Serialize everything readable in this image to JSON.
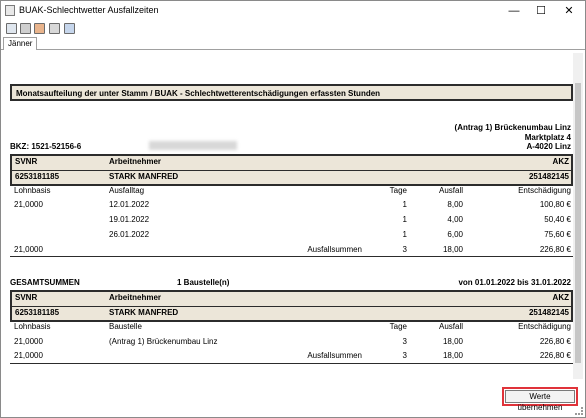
{
  "window": {
    "title": "BUAK-Schlechtwetter Ausfallzeiten"
  },
  "controls": {
    "minimize": "—",
    "maximize": "☐",
    "close": "✕"
  },
  "tabs": [
    {
      "label": "Jänner"
    }
  ],
  "report": {
    "heading": "Monatsaufteilung der unter Stamm / BUAK - Schlechtwetterentschädigungen erfassten Stunden",
    "address": {
      "line1": "(Antrag 1) Brückenumbau Linz",
      "line2": "Marktplatz 4",
      "line3": "A-4020 Linz"
    },
    "bkz": "BKZ: 1521-52156-6",
    "section1": {
      "header": {
        "svnr_label": "SVNR",
        "arbeitnehmer_label": "Arbeitnehmer",
        "akz_label": "AKZ"
      },
      "employee": {
        "svnr": "6253181185",
        "name": "STARK MANFRED",
        "akz": "251482145"
      },
      "columns": {
        "lohnbasis": "Lohnbasis",
        "ausfalltag": "Ausfalltag",
        "tage": "Tage",
        "ausfall": "Ausfall",
        "entschaedigung": "Entschädigung"
      },
      "rows": [
        {
          "lohnbasis": "21,0000",
          "datum": "12.01.2022",
          "tage": "1",
          "ausfall": "8,00",
          "entschaedigung": "100,80 €"
        },
        {
          "lohnbasis": "",
          "datum": "19.01.2022",
          "tage": "1",
          "ausfall": "4,00",
          "entschaedigung": "50,40 €"
        },
        {
          "lohnbasis": "",
          "datum": "26.01.2022",
          "tage": "1",
          "ausfall": "6,00",
          "entschaedigung": "75,60 €"
        }
      ],
      "sum": {
        "lohnbasis": "21,0000",
        "label": "Ausfallsummen",
        "tage": "3",
        "ausfall": "18,00",
        "entschaedigung": "226,80 €"
      }
    },
    "totals": {
      "label": "GESAMTSUMMEN",
      "baustellen": "1 Baustelle(n)",
      "period": "von 01.01.2022 bis 31.01.2022",
      "header": {
        "svnr_label": "SVNR",
        "arbeitnehmer_label": "Arbeitnehmer",
        "akz_label": "AKZ"
      },
      "employee": {
        "svnr": "6253181185",
        "name": "STARK MANFRED",
        "akz": "251482145"
      },
      "columns": {
        "lohnbasis": "Lohnbasis",
        "baustelle": "Baustelle",
        "tage": "Tage",
        "ausfall": "Ausfall",
        "entschaedigung": "Entschädigung"
      },
      "row": {
        "lohnbasis": "21,0000",
        "baustelle": "(Antrag 1) Brückenumbau Linz",
        "tage": "3",
        "ausfall": "18,00",
        "entschaedigung": "226,80 €"
      },
      "sum": {
        "lohnbasis": "21,0000",
        "label": "Ausfallsummen",
        "tage": "3",
        "ausfall": "18,00",
        "entschaedigung": "226,80 €"
      }
    }
  },
  "buttons": {
    "apply": "Werte übernehmen"
  },
  "icons": [
    "app-icon",
    "print-preview-icon",
    "print-icon",
    "export-icon",
    "settings-icon",
    "page-icon"
  ],
  "colors": {
    "header_fill": "#ece6d9",
    "highlight": "#e0333a"
  }
}
